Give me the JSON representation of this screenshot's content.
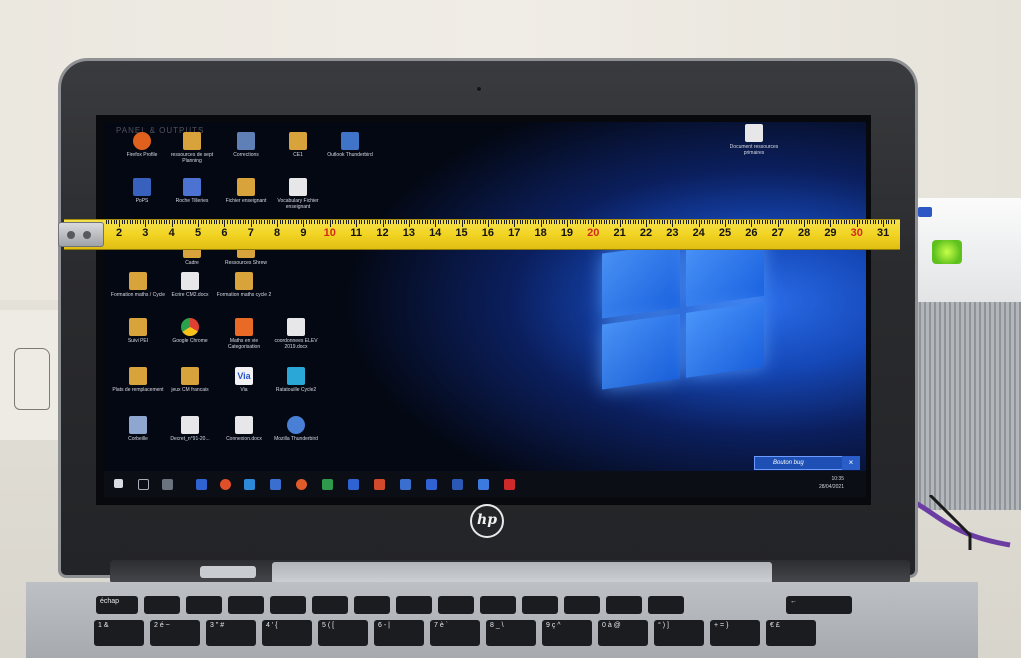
{
  "screen": {
    "brand_text": "PANEL & OUTPUTS",
    "desktop_icons": [
      {
        "label": "Firefox Profile"
      },
      {
        "label": "ressources de sept Planning"
      },
      {
        "label": "Corrections"
      },
      {
        "label": "CE1"
      },
      {
        "label": "Outlook Thunderbird"
      },
      {
        "label": "PoPS"
      },
      {
        "label": "Roche Tilleries"
      },
      {
        "label": "Fichier enseignant"
      },
      {
        "label": "Vocabulary Fichier enseignant"
      },
      {
        "label": "Cadre"
      },
      {
        "label": "Ressources Shrew"
      },
      {
        "label": "Formation maths / Cycle"
      },
      {
        "label": "Ecrire CM2.docx"
      },
      {
        "label": "Formation maths cycle 2"
      },
      {
        "label": "Suivi PEI"
      },
      {
        "label": "Google Chrome"
      },
      {
        "label": "Maths en vie Categorisation"
      },
      {
        "label": "coordonnees ELEV 2019.docx"
      },
      {
        "label": "Plats de remplacement"
      },
      {
        "label": "jeux CM francais"
      },
      {
        "label": "Via"
      },
      {
        "label": "Ratatouille Cycle2"
      },
      {
        "label": "Corbeille"
      },
      {
        "label": "Decret_n°91-20..."
      },
      {
        "label": "Connexion.docx"
      },
      {
        "label": "Mozilla Thunderbird"
      },
      {
        "label": "Document ressources primaires"
      }
    ],
    "notification_text": "Bouton bug",
    "tray_time": "10:35",
    "tray_date": "28/04/2021"
  },
  "laptop": {
    "logo_text": "hp"
  },
  "tape": {
    "numbers": [
      "2",
      "3",
      "4",
      "5",
      "6",
      "7",
      "8",
      "9",
      "10",
      "11",
      "12",
      "13",
      "14",
      "15",
      "16",
      "17",
      "18",
      "19",
      "20",
      "21",
      "22",
      "23",
      "24",
      "25",
      "26",
      "27",
      "28",
      "29",
      "30",
      "31"
    ],
    "red_numbers": [
      "10",
      "20",
      "30"
    ]
  },
  "keyboard": {
    "keys": [
      "échap",
      "",
      "",
      "",
      "",
      "",
      "",
      "",
      "",
      "",
      "",
      "",
      "",
      "",
      "←",
      "1 &",
      "2 é ~",
      "3 \" #",
      "4 ' {",
      "5 ( [",
      "6 - |",
      "7 è `",
      "8 _ \\",
      "9 ç ^",
      "0 à @",
      "° ) ]",
      "+ = }",
      "€ £"
    ]
  },
  "colors": {
    "tape_yellow": "#f2d423",
    "screen_blue": "#1548b8",
    "bezel": "#2a2b2e",
    "tape_red_numbers": "#d42a1d"
  },
  "icons": [
    "webcam-icon",
    "hp-logo-icon",
    "windows-logo-icon",
    "speaker-icon",
    "tape-hook-icon"
  ]
}
